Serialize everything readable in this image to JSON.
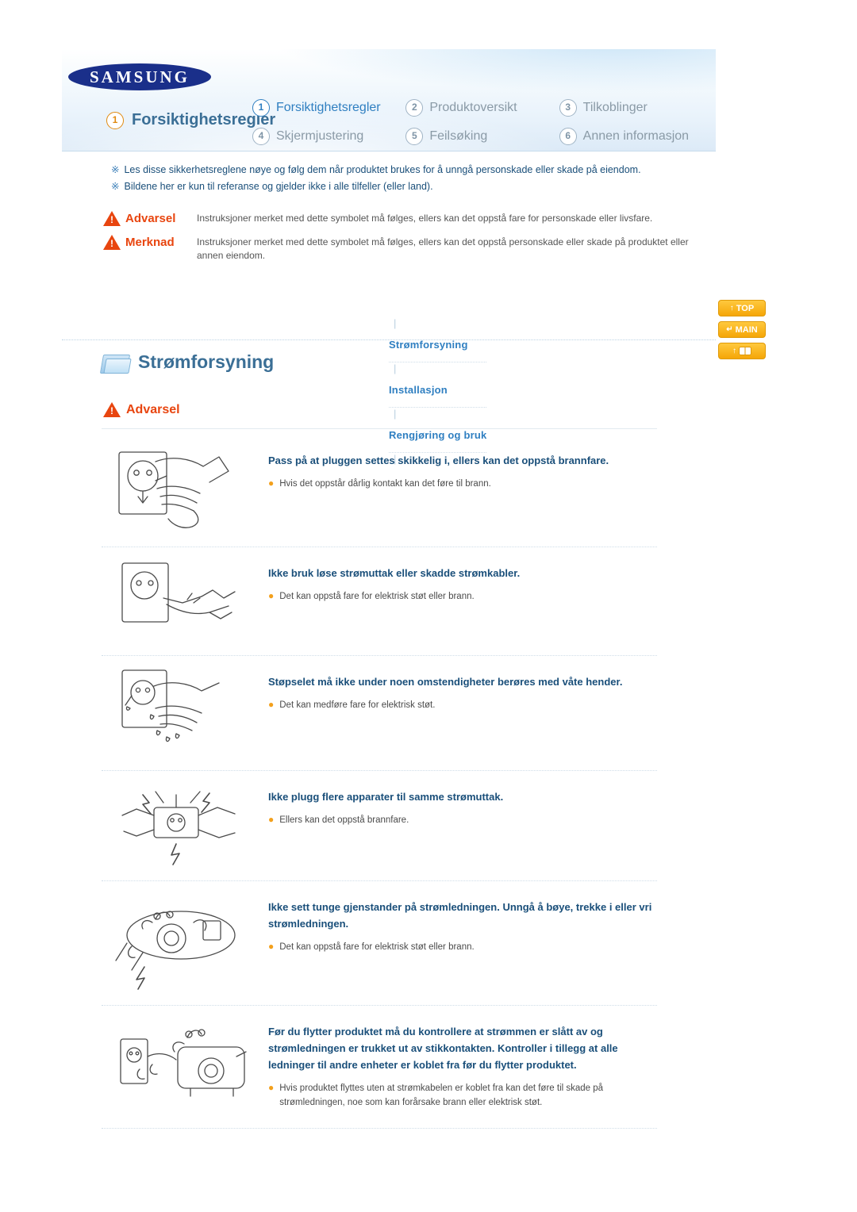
{
  "header": {
    "logo": "SAMSUNG",
    "section": {
      "number": "1",
      "label": "Forsiktighetsregler"
    },
    "nav": [
      {
        "number": "1",
        "label": "Forsiktighetsregler",
        "active": true
      },
      {
        "number": "2",
        "label": "Produktoversikt",
        "active": false
      },
      {
        "number": "3",
        "label": "Tilkoblinger",
        "active": false
      },
      {
        "number": "4",
        "label": "Skjermjustering",
        "active": false
      },
      {
        "number": "5",
        "label": "Feilsøking",
        "active": false
      },
      {
        "number": "6",
        "label": "Annen informasjon",
        "active": false
      }
    ]
  },
  "intro": {
    "mark": "※",
    "line1": "Les disse sikkerhetsreglene nøye og følg dem når produktet brukes for å unngå personskade eller skade på eiendom.",
    "line2": "Bildene her er kun til referanse og gjelder ikke i alle tilfeller (eller land)."
  },
  "legend": [
    {
      "badge": "Advarsel",
      "text": "Instruksjoner merket med dette symbolet må følges, ellers kan det oppstå fare for personskade eller livsfare."
    },
    {
      "badge": "Merknad",
      "text": "Instruksjoner merket med dette symbolet må følges, ellers kan det oppstå personskade eller skade på produktet eller annen eiendom."
    }
  ],
  "subnav": {
    "items": [
      "Strømforsyning",
      "Installasjon",
      "Rengjøring og bruk"
    ],
    "separator": "|"
  },
  "side_buttons": [
    {
      "label": "TOP",
      "arrow": "↑"
    },
    {
      "label": "MAIN",
      "arrow": "↵"
    },
    {
      "label": "",
      "arrow": "↑"
    }
  ],
  "block": {
    "title": "Strømforsyning",
    "warning_label": "Advarsel"
  },
  "items": [
    {
      "title": "Pass på at pluggen settes skikkelig i, ellers kan det oppstå brannfare.",
      "bullets": [
        "Hvis det oppstår dårlig kontakt kan det føre til brann."
      ],
      "art": "hand-plugging-in-socket"
    },
    {
      "title": "Ikke bruk løse strømuttak eller skadde strømkabler.",
      "bullets": [
        "Det kan oppstå fare for elektrisk støt eller brann."
      ],
      "art": "damaged-cable-socket"
    },
    {
      "title": "Støpselet må ikke under noen omstendigheter berøres med våte hender.",
      "bullets": [
        "Det kan medføre fare for elektrisk støt."
      ],
      "art": "wet-hands-plug"
    },
    {
      "title": "Ikke plugg flere apparater til samme strømuttak.",
      "bullets": [
        "Ellers kan det oppstå brannfare."
      ],
      "art": "overloaded-outlet"
    },
    {
      "title": "Ikke sett tunge gjenstander på strømledningen. Unngå å bøye, trekke i eller vri strømledningen.",
      "bullets": [
        "Det kan oppstå fare for elektrisk støt eller brann."
      ],
      "art": "heavy-object-on-cord"
    },
    {
      "title": "Før du flytter produktet må du kontrollere at strømmen er slått av og strømledningen er trukket ut av stikkontakten. Kontroller i tillegg at alle ledninger til andre enheter er koblet fra før du flytter produktet.",
      "bullets": [
        "Hvis produktet flyttes uten at strømkabelen er koblet fra kan det føre til skade på strømledningen, noe som kan forårsake brann eller elektrisk støt."
      ],
      "art": "moving-product-unplug"
    }
  ],
  "colors": {
    "accent_blue": "#2f7fc1",
    "title_blue": "#1a4f7a",
    "warning_red": "#e8450f",
    "button_orange": "#f5a607",
    "bullet_orange": "#f3a01c"
  }
}
